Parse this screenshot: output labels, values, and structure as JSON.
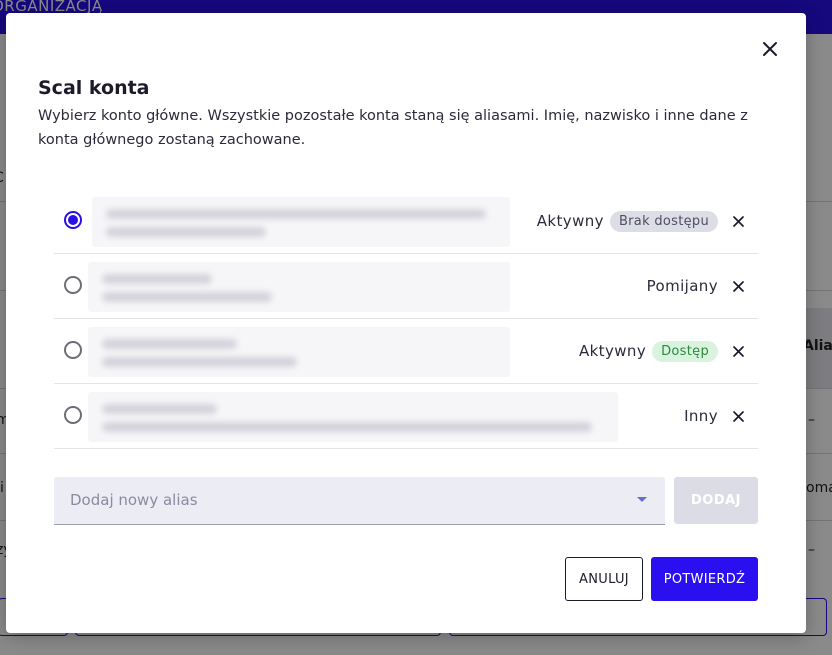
{
  "background": {
    "topbar_title": "ORGANIZACJĄ",
    "column_header_fragment": "Alias",
    "cell_fragment_1": "m",
    "cell_fragment_2": "i",
    "cell_fragment_3": "zy",
    "cell_fragment_4": "C",
    "cell_fragment_5": "oma",
    "dash_1": "–",
    "dash_2": "–"
  },
  "modal": {
    "title": "Scal konta",
    "description": "Wybierz konto główne. Wszystkie pozostałe konta staną się aliasami. Imię, nazwisko i inne dane z konta głównego zostaną zachowane.",
    "close_icon": "close-icon",
    "accounts": [
      {
        "selected": true,
        "status": "Aktywny",
        "badge": "Brak dostępu"
      },
      {
        "selected": false,
        "status": "Pomijany",
        "badge": ""
      },
      {
        "selected": false,
        "status": "Aktywny",
        "badge": "Dostęp"
      },
      {
        "selected": false,
        "status": "Inny",
        "badge": ""
      }
    ],
    "alias_placeholder": "Dodaj nowy alias",
    "add_label": "DODAJ",
    "cancel_label": "ANULUJ",
    "confirm_label": "POTWIERDŹ"
  },
  "colors": {
    "accent": "#2a10f0",
    "badge_gray": "#dddde6",
    "badge_green": "#d9f3df"
  }
}
